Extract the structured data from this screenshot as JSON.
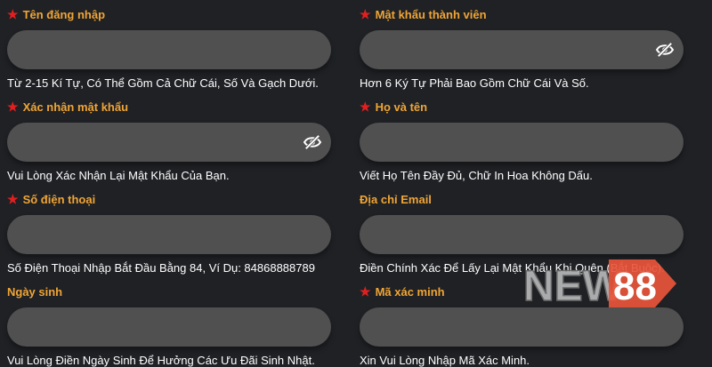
{
  "form": {
    "fields": [
      {
        "label": "Tên đăng nhập",
        "required": true,
        "value": "",
        "hint": "Từ 2-15 Kí Tự, Có Thể Gồm Cả Chữ Cái, Số Và Gạch Dưới."
      },
      {
        "label": "Mật khẩu thành viên",
        "required": true,
        "value": "",
        "hint": "Hơn 6 Ký Tự Phải Bao Gồm Chữ Cái Và Số.",
        "icon": "eye-slash-icon"
      },
      {
        "label": "Xác nhận mật khẩu",
        "required": true,
        "value": "",
        "hint": "Vui Lòng Xác Nhận Lại Mật Khẩu Của Bạn.",
        "icon": "eye-slash-icon"
      },
      {
        "label": "Họ và tên",
        "required": true,
        "value": "",
        "hint": "Viết Họ Tên Đầy Đủ, Chữ In Hoa Không Dấu."
      },
      {
        "label": "Số điện thoại",
        "required": true,
        "value": "",
        "hint": "Số Điện Thoại Nhập Bắt Đầu Bằng 84, Ví Dụ: 84868888789"
      },
      {
        "label": "Địa chỉ Email",
        "required": false,
        "value": "",
        "hint": "Điền Chính Xác Để Lấy Lại Mật Khẩu Khi Quên (Bắt Buộc)."
      },
      {
        "label": "Ngày sinh",
        "required": false,
        "value": "",
        "hint": "Vui Lòng Điền Ngày Sinh Để Hưởng Các Ưu Đãi Sinh Nhật."
      },
      {
        "label": "Mã xác minh",
        "required": true,
        "value": "",
        "hint": "Xin Vui Lòng Nhập Mã Xác Minh."
      }
    ]
  },
  "watermark": {
    "text_a": "NEW",
    "text_b": "88",
    "color_a": "#d9d9d9",
    "color_b": "#e8553a"
  },
  "colors": {
    "label": "#f0a535",
    "star": "#e02020",
    "input_bg": "#505050",
    "page_bg": "#1f2125",
    "hint": "#ffffff"
  }
}
